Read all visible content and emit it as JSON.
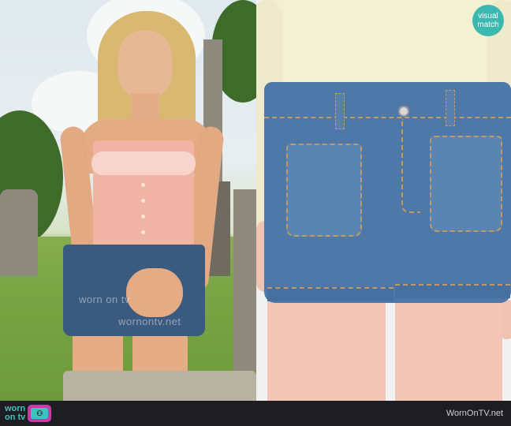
{
  "badge": {
    "line1": "visual",
    "line2": "match"
  },
  "watermarks": [
    "worn on tv",
    "wornontv.net"
  ],
  "footer": {
    "logo_word1": "worn",
    "logo_word2": "on tv",
    "url": "WornOnTV.net"
  },
  "colors": {
    "brand_teal": "#3cc3bd",
    "brand_magenta": "#c73ba8",
    "bar_background": "#1d1d22",
    "denim": "#4e78a7"
  },
  "icons": [
    "tv-icon"
  ]
}
